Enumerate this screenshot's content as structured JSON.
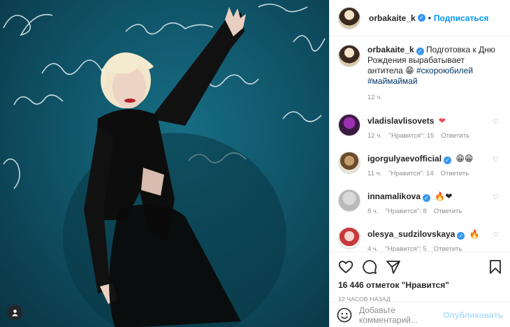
{
  "post_owner": {
    "username": "orbakaite_k",
    "follow_label": "Подписаться"
  },
  "caption": {
    "username": "orbakaite_k",
    "text": "Подготовка к Дню Рождения вырабатывает антитела 😁",
    "hashtags": "#скороюбилей #маймаймай",
    "time": "12 ч."
  },
  "comments": [
    {
      "username": "vladislavlisovets",
      "text": "❤",
      "time": "12 ч.",
      "likes": "\"Нравится\": 15",
      "reply": "Ответить",
      "verified": false
    },
    {
      "username": "igorgulyaevofficial",
      "text": "😁😁",
      "time": "11 ч.",
      "likes": "\"Нравится\": 14",
      "reply": "Ответить",
      "verified": true
    },
    {
      "username": "innamalikova",
      "text": "🔥❤",
      "time": "8 ч.",
      "likes": "\"Нравится\": 8",
      "reply": "Ответить",
      "verified": true
    },
    {
      "username": "olesya_sudzilovskaya",
      "text": "🔥",
      "time": "4 ч.",
      "likes": "\"Нравится\": 5",
      "reply": "Ответить",
      "verified": true
    }
  ],
  "engagement": {
    "likes": "16 446 отметок \"Нравится\"",
    "posted": "12 ЧАСОВ НАЗАД"
  },
  "add_comment": {
    "placeholder": "Добавьте комментарий...",
    "post_label": "Опубликовать"
  },
  "icons": {
    "like": "heart-icon",
    "comment": "comment-icon",
    "share": "share-icon",
    "save": "bookmark-icon",
    "emoji": "emoji-icon",
    "verified": "verified-badge-icon",
    "tag": "user-tag-icon"
  },
  "colors": {
    "accent": "#0095f6",
    "verified": "#3897f0",
    "muted": "#8e8e8e",
    "photo_bg": "#11586d"
  }
}
